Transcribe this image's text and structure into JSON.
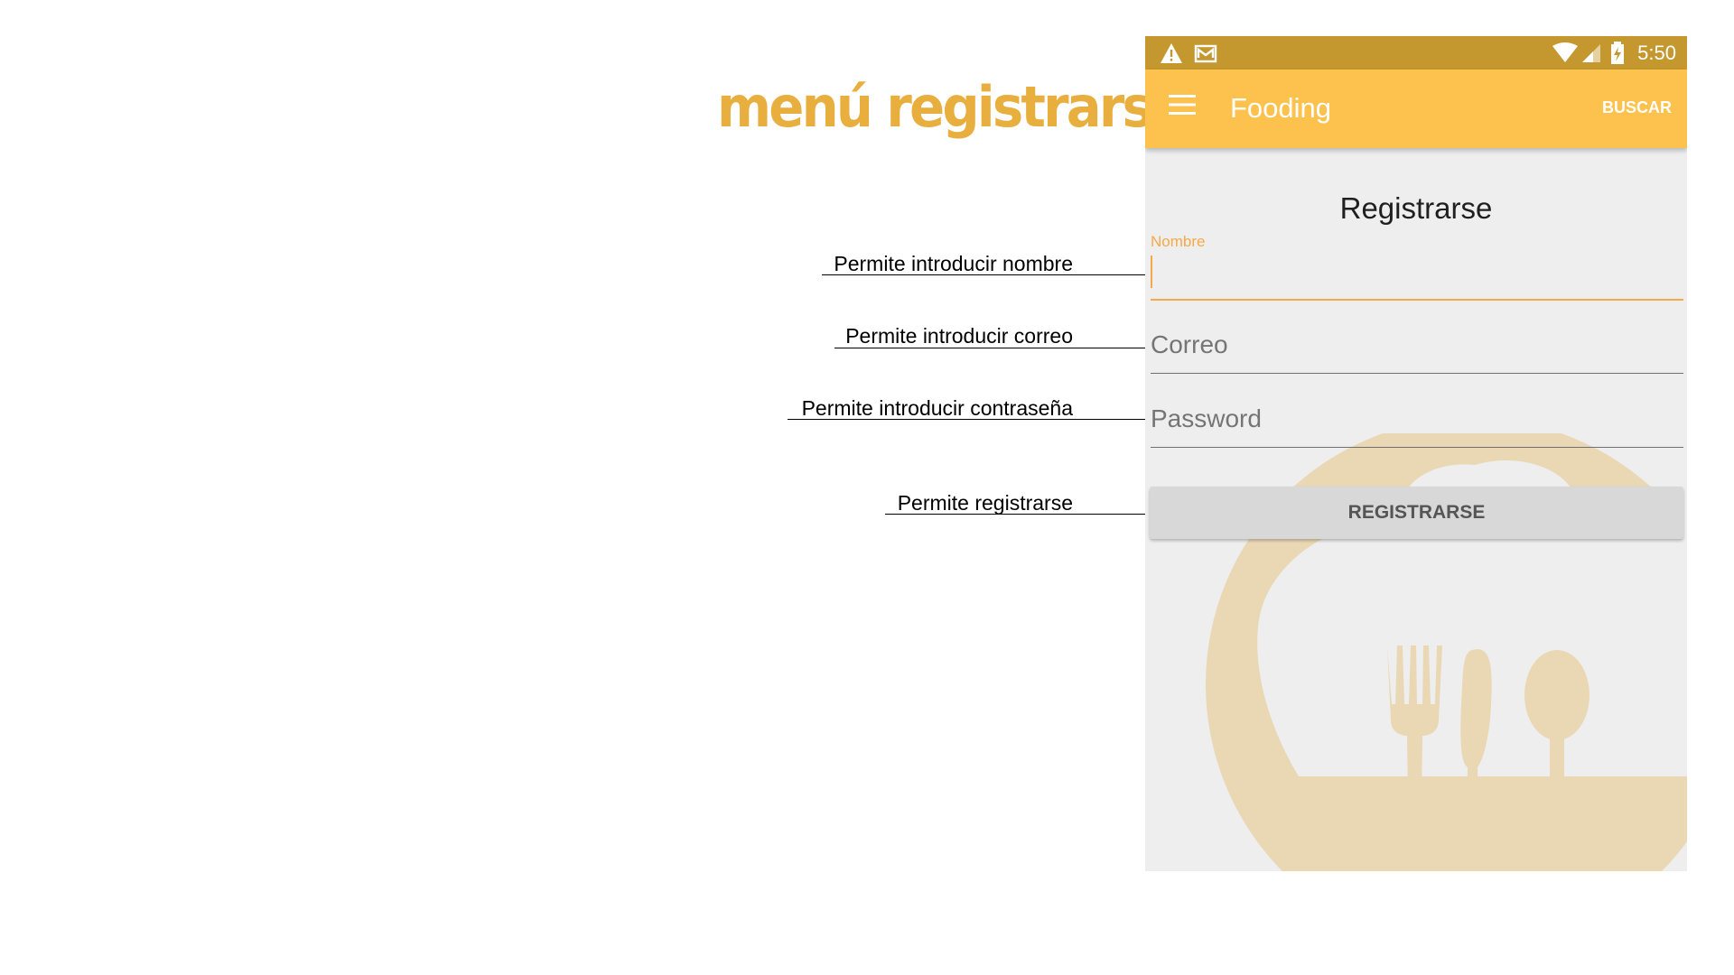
{
  "slide": {
    "title": "menú registrarse",
    "annotations": {
      "nombre": "Permite introducir nombre",
      "correo": "Permite introducir correo",
      "password": "Permite introducir contraseña",
      "registrarse": "Permite registrarse"
    }
  },
  "status_bar": {
    "icons": [
      "warning-icon",
      "gmail-icon",
      "wifi-icon",
      "signal-icon",
      "battery-charging-icon"
    ],
    "time": "5:50",
    "color": "#c4982e"
  },
  "app_bar": {
    "menu_icon": "hamburger-menu-icon",
    "title": "Fooding",
    "action": "BUSCAR",
    "color": "#fcc24d"
  },
  "form": {
    "title": "Registrarse",
    "nombre": {
      "label": "Nombre",
      "value": ""
    },
    "correo": {
      "placeholder": "Correo",
      "value": ""
    },
    "password": {
      "placeholder": "Password",
      "value": ""
    },
    "submit_label": "REGISTRARSE"
  },
  "background": {
    "icon": "chef-hat-cutlery-logo",
    "color": "#ead8b5"
  },
  "colors": {
    "accent": "#f5a948",
    "title_accent": "#e8ae3e"
  }
}
